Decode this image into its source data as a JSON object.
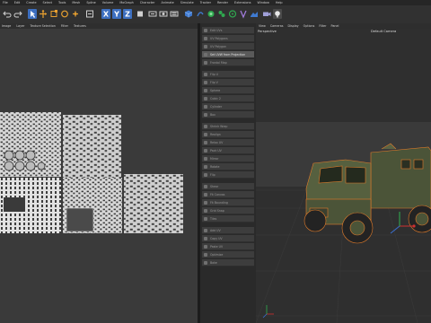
{
  "menu": [
    "File",
    "Edit",
    "Create",
    "Select",
    "Tools",
    "Mesh",
    "Spline",
    "Volume",
    "MoGraph",
    "Character",
    "Animate",
    "Simulate",
    "Tracker",
    "Render",
    "Extensions",
    "Window",
    "Help"
  ],
  "toolbar": {
    "undo_icon": "undo-icon",
    "axis_x": "X",
    "axis_y": "Y",
    "axis_z": "Z"
  },
  "uv_menu": [
    "Image",
    "Layer",
    "Texture Selection",
    "Filter",
    "Textures"
  ],
  "panel": {
    "items": [
      "Edit UVs",
      "UV Polygons",
      "UV Polygon",
      "Set UVW from Projection",
      "Frontal Map",
      "Flip U",
      "Flip V",
      "Sphere",
      "Cubic 2",
      "Cylinder",
      "Box",
      "Shrink Wrap",
      "Realign",
      "Relax UV",
      "Pack UV",
      "Mirror",
      "Rotate",
      "Flip",
      "Shear",
      "Fit Canvas",
      "Fit Bounding",
      "Grid Snap",
      "Tiles",
      "Add UV",
      "Copy UV",
      "Paste UV",
      "Optimize",
      "Bake"
    ],
    "highlight_index": 3
  },
  "viewport_menu": [
    "View",
    "Cameras",
    "Display",
    "Options",
    "Filter",
    "Panel"
  ],
  "viewport": {
    "name": "Perspective",
    "camera": "Default Camera"
  },
  "colors": {
    "accent": "#3f7ad0",
    "truck_green": "#4b5438",
    "highlight": "#e07b2a"
  }
}
